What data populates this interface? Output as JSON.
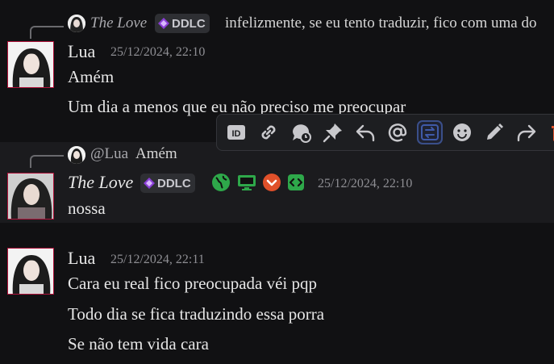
{
  "messages": [
    {
      "reply_to": {
        "author": "The Love",
        "badge": "DDLC",
        "text": "infelizmente, se eu tento traduzir, fico com uma do"
      },
      "author": "Lua",
      "timestamp": "25/12/2024, 22:10",
      "lines": [
        "Amém",
        "Um dia a menos que eu não preciso me preocupar"
      ]
    },
    {
      "reply_to": {
        "author": "@Lua",
        "text": "Amém"
      },
      "author": "The Love",
      "badge": "DDLC",
      "timestamp": "25/12/2024, 22:10",
      "lines": [
        "nossa"
      ]
    },
    {
      "author": "Lua",
      "timestamp": "25/12/2024, 22:11",
      "lines": [
        "Cara eu real fico preocupada véi pqp",
        "Todo dia se fica traduzindo essa porra",
        "Se não tem vida cara"
      ]
    }
  ],
  "toolbar": {
    "buttons": [
      "copy-id-icon",
      "copy-link-icon",
      "reply-icon-clock",
      "pin-icon",
      "reply-icon",
      "mention-icon",
      "translate-icon",
      "emoji-icon",
      "edit-icon",
      "forward-icon",
      "delete-icon"
    ]
  },
  "colors": {
    "background": "#111113",
    "hover_row": "#1b1b1e",
    "avatar_border": "#b0123a",
    "badge_bg": "#2e2f33",
    "status_green": "#2ea84a",
    "status_orange": "#e0502a"
  }
}
